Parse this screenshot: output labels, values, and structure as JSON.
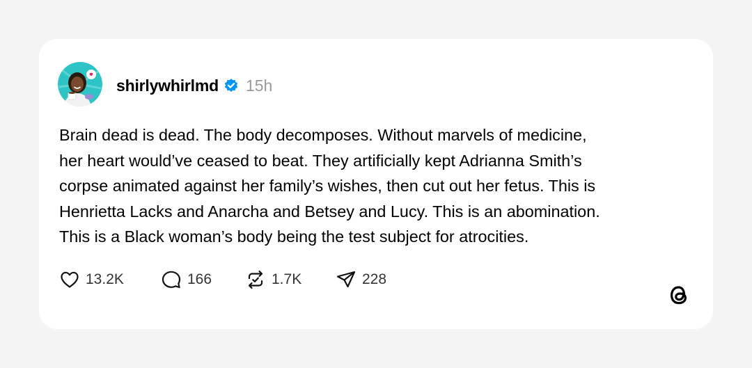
{
  "post": {
    "username": "shirlywhirlmd",
    "timestamp": "15h",
    "verified": true,
    "text_lines": [
      "Brain dead is dead. The body decomposes. Without marvels of medicine,",
      "her heart would’ve ceased to beat. They artificially kept Adrianna Smith’s",
      "corpse animated against her family’s wishes, then cut out her fetus. This is",
      "Henrietta Lacks and Anarcha and Betsey and Lucy. This is an abomination.",
      "This is a Black woman’s body being the test subject for atrocities."
    ]
  },
  "actions": {
    "likes": "13.2K",
    "replies": "166",
    "reposts": "1.7K",
    "shares": "228"
  },
  "icons": {
    "avatar": "profile-photo",
    "verified": "verified-badge-icon",
    "like": "heart-icon",
    "reply": "comment-bubble-icon",
    "repost": "repost-icon",
    "share": "send-icon",
    "brand": "threads-logo-icon"
  },
  "colors": {
    "background": "#f4f4f4",
    "card": "#ffffff",
    "verified_blue": "#0095f6",
    "timestamp_gray": "#999999",
    "avatar_teal": "#2ec4c6"
  }
}
